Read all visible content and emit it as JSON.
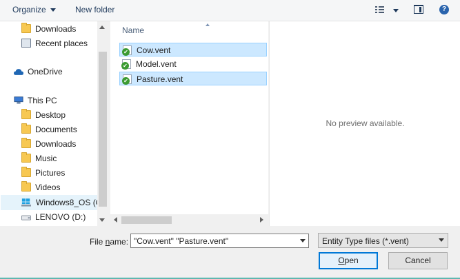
{
  "toolbar": {
    "organize_label": "Organize",
    "new_folder_label": "New folder",
    "help_label": "?"
  },
  "nav": {
    "items": [
      {
        "label": "Downloads",
        "icon": "download-folder-icon"
      },
      {
        "label": "Recent places",
        "icon": "recent-places-icon"
      },
      {
        "label": "OneDrive",
        "icon": "onedrive-icon"
      },
      {
        "label": "This PC",
        "icon": "computer-icon"
      },
      {
        "label": "Desktop",
        "icon": "desktop-folder-icon"
      },
      {
        "label": "Documents",
        "icon": "documents-folder-icon"
      },
      {
        "label": "Downloads",
        "icon": "download-folder-icon"
      },
      {
        "label": "Music",
        "icon": "music-folder-icon"
      },
      {
        "label": "Pictures",
        "icon": "pictures-folder-icon"
      },
      {
        "label": "Videos",
        "icon": "videos-folder-icon"
      },
      {
        "label": "Windows8_OS (C",
        "icon": "windows-drive-icon"
      },
      {
        "label": "LENOVO (D:)",
        "icon": "drive-icon"
      }
    ]
  },
  "filelist": {
    "column_name": "Name",
    "files": [
      {
        "label": "Cow.vent",
        "selected": true
      },
      {
        "label": "Model.vent",
        "selected": false
      },
      {
        "label": "Pasture.vent",
        "selected": true
      }
    ]
  },
  "preview": {
    "message": "No preview available."
  },
  "bottom": {
    "file_name_label_pre": "File ",
    "file_name_label_u": "n",
    "file_name_label_post": "ame:",
    "file_name_value": "\"Cow.vent\" \"Pasture.vent\"",
    "file_type_value": "Entity Type files (*.vent)",
    "open_label_u": "O",
    "open_label_rest": "pen",
    "cancel_label": "Cancel"
  },
  "colors": {
    "accent": "#0078d7",
    "selection": "#cce8ff",
    "link_text": "#1e395b"
  }
}
